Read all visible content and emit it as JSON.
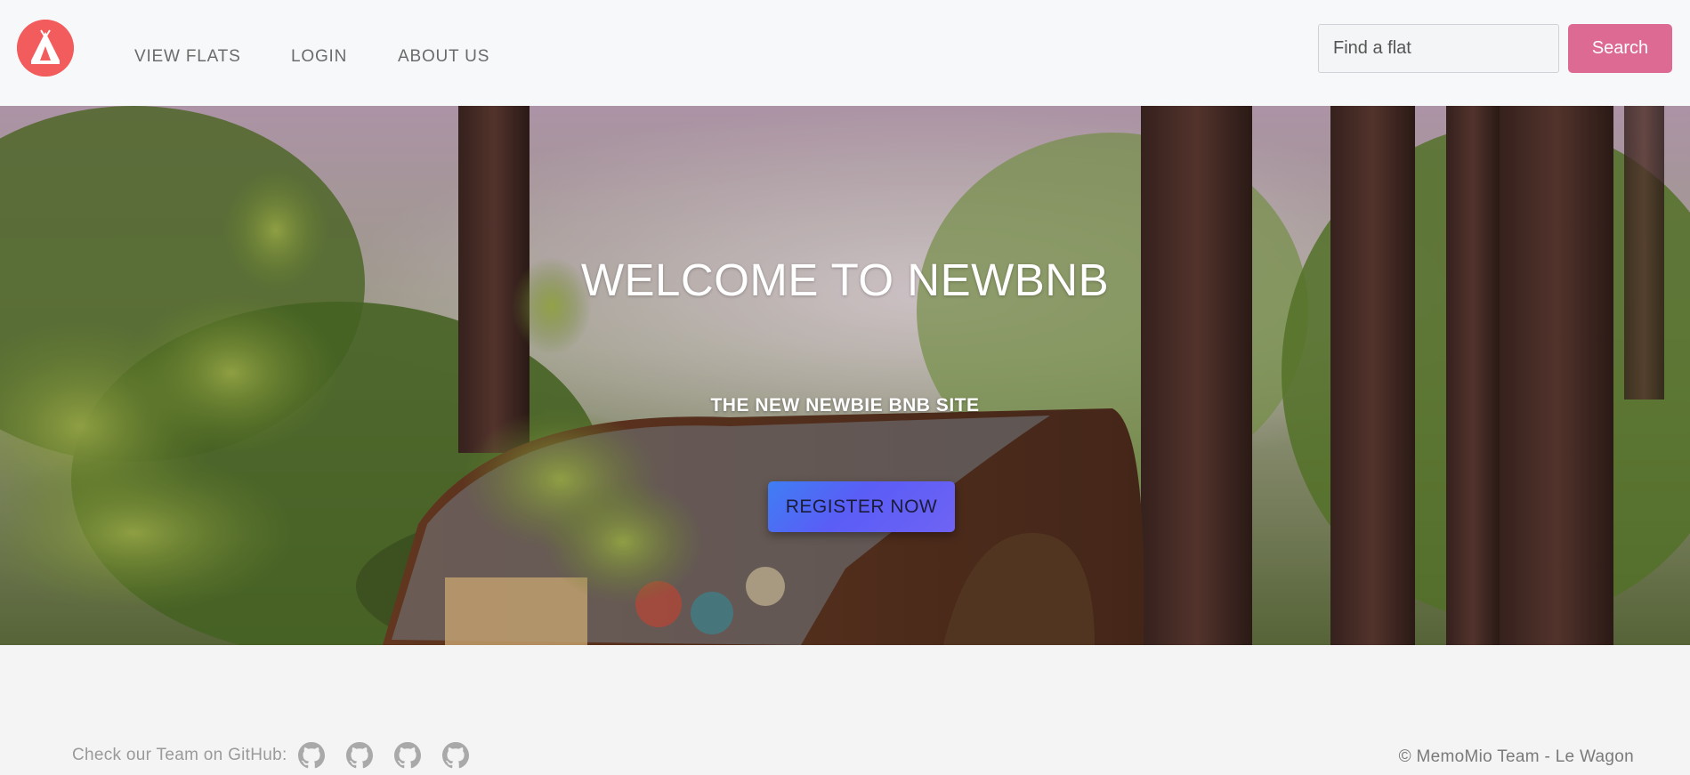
{
  "nav": {
    "logo": "tent-logo-icon",
    "links": [
      "VIEW FLATS",
      "LOGIN",
      "ABOUT US"
    ],
    "search_placeholder": "Find a flat",
    "search_button": "Search"
  },
  "hero": {
    "title": "WELCOME TO NEWBNB",
    "subtitle": "THE NEW NEWBIE BNB SITE",
    "cta": "REGISTER NOW"
  },
  "footer": {
    "team_text": "Check our Team on GitHub:",
    "github_icons": [
      "github-icon",
      "github-icon",
      "github-icon",
      "github-icon"
    ],
    "copyright": "© MemoMio Team - Le Wagon"
  },
  "colors": {
    "brand": "#f35c5c",
    "search_button": "#dc6a93",
    "cta": "#5a5df6"
  }
}
